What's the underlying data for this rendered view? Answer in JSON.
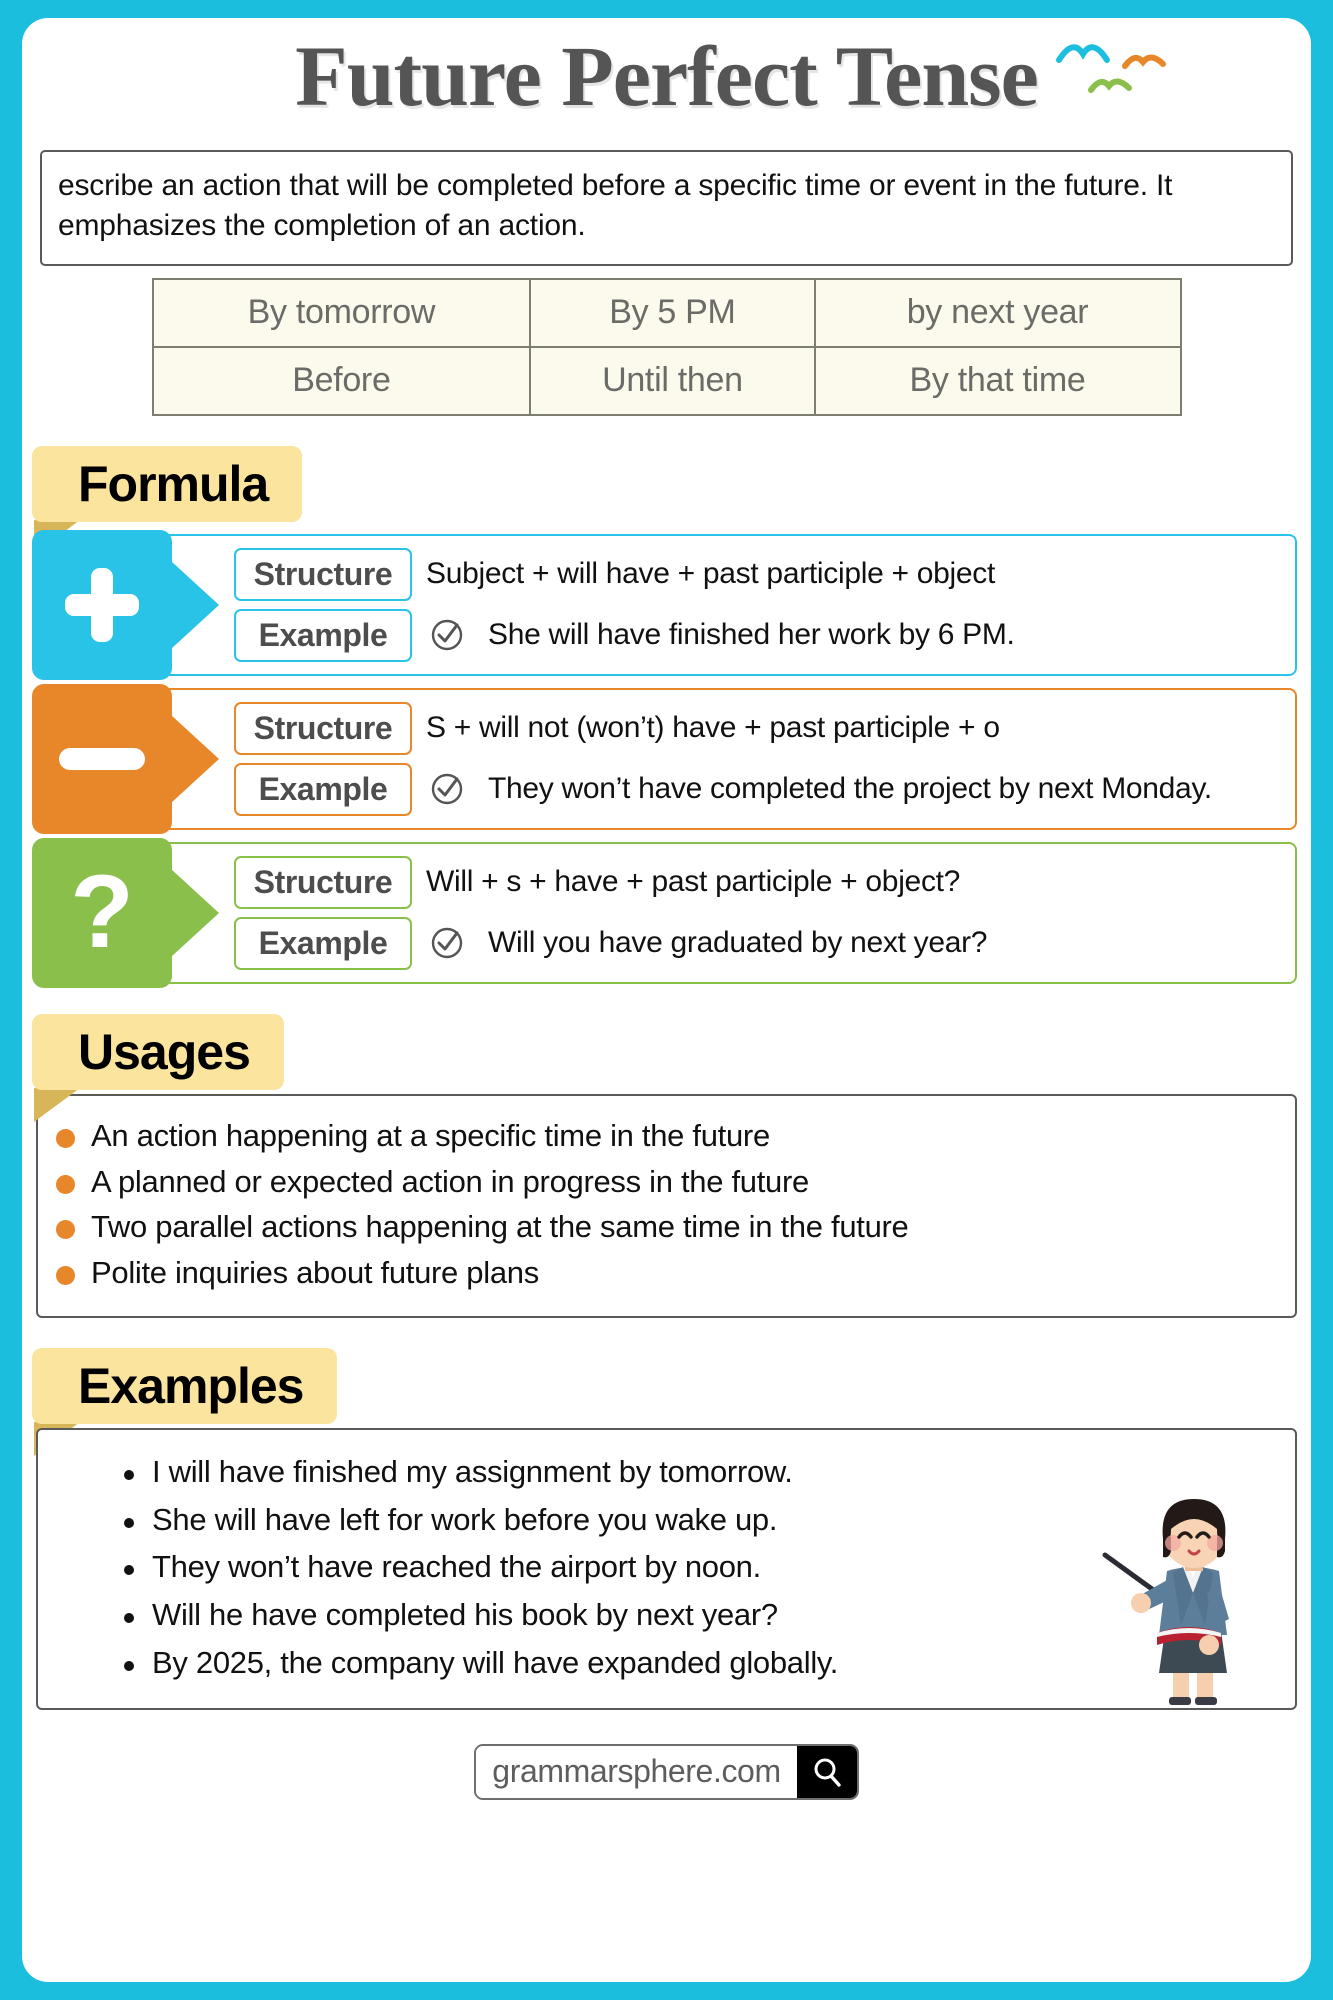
{
  "colors": {
    "frame": "#1BBFDD",
    "banner_yellow": "#FBE49D",
    "banner_fold": "#D8B559",
    "positive": "#2AC3E8",
    "negative": "#E8872A",
    "question": "#8BBF4B",
    "table_cell": "#FCFAEC",
    "title_gray": "#555555"
  },
  "header": {
    "title": "Future Perfect Tense",
    "birds": [
      "bird-cyan",
      "bird-orange",
      "bird-green"
    ]
  },
  "definition": {
    "text": "escribe an action that will be completed before a specific time or event in the future. It emphasizes the completion of an action."
  },
  "time_expressions": {
    "rows": [
      [
        "By tomorrow",
        "By 5 PM",
        "by next year"
      ],
      [
        "Before",
        "Until then",
        "By that time"
      ]
    ]
  },
  "sections": {
    "formula_label": "Formula",
    "usages_label": "Usages",
    "examples_label": "Examples"
  },
  "formula": {
    "rows": [
      {
        "type": "positive",
        "icon": "plus-icon",
        "structure_label": "Structure",
        "structure_text": "Subject + will have + past participle + object",
        "example_label": "Example",
        "example_text": "She will have finished her work by 6 PM."
      },
      {
        "type": "negative",
        "icon": "minus-icon",
        "structure_label": "Structure",
        "structure_text": "S + will not (won’t) have + past participle + o",
        "example_label": "Example",
        "example_text": "They won’t have completed the project by next Monday."
      },
      {
        "type": "question",
        "icon": "question-mark-icon",
        "structure_label": "Structure",
        "structure_text": "Will + s + have + past participle + object?",
        "example_label": "Example",
        "example_text": "Will you have graduated by next year?"
      }
    ]
  },
  "usages": {
    "items": [
      "An action happening at a specific time in the future",
      "A planned or expected action in progress in the future",
      "Two parallel actions happening at the same time in the future",
      "Polite inquiries about future plans"
    ]
  },
  "examples": {
    "items": [
      "I will have finished my assignment by tomorrow.",
      "She will have left for work before you wake up.",
      "They won’t have reached the airport by noon.",
      "Will he have completed his book by next year?",
      "By 2025, the company will have expanded globally."
    ],
    "illustration": "teacher-with-pointer-illustration"
  },
  "footer": {
    "site": "grammarsphere.com",
    "icon": "search-icon"
  }
}
